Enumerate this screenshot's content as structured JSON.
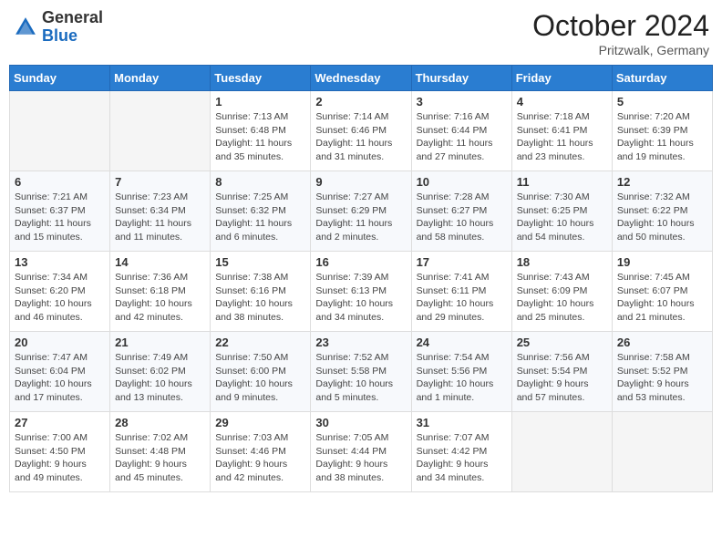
{
  "header": {
    "logo_general": "General",
    "logo_blue": "Blue",
    "month_year": "October 2024",
    "location": "Pritzwalk, Germany"
  },
  "days_of_week": [
    "Sunday",
    "Monday",
    "Tuesday",
    "Wednesday",
    "Thursday",
    "Friday",
    "Saturday"
  ],
  "weeks": [
    [
      {
        "day": "",
        "sunrise": "",
        "sunset": "",
        "daylight": ""
      },
      {
        "day": "",
        "sunrise": "",
        "sunset": "",
        "daylight": ""
      },
      {
        "day": "1",
        "sunrise": "Sunrise: 7:13 AM",
        "sunset": "Sunset: 6:48 PM",
        "daylight": "Daylight: 11 hours and 35 minutes."
      },
      {
        "day": "2",
        "sunrise": "Sunrise: 7:14 AM",
        "sunset": "Sunset: 6:46 PM",
        "daylight": "Daylight: 11 hours and 31 minutes."
      },
      {
        "day": "3",
        "sunrise": "Sunrise: 7:16 AM",
        "sunset": "Sunset: 6:44 PM",
        "daylight": "Daylight: 11 hours and 27 minutes."
      },
      {
        "day": "4",
        "sunrise": "Sunrise: 7:18 AM",
        "sunset": "Sunset: 6:41 PM",
        "daylight": "Daylight: 11 hours and 23 minutes."
      },
      {
        "day": "5",
        "sunrise": "Sunrise: 7:20 AM",
        "sunset": "Sunset: 6:39 PM",
        "daylight": "Daylight: 11 hours and 19 minutes."
      }
    ],
    [
      {
        "day": "6",
        "sunrise": "Sunrise: 7:21 AM",
        "sunset": "Sunset: 6:37 PM",
        "daylight": "Daylight: 11 hours and 15 minutes."
      },
      {
        "day": "7",
        "sunrise": "Sunrise: 7:23 AM",
        "sunset": "Sunset: 6:34 PM",
        "daylight": "Daylight: 11 hours and 11 minutes."
      },
      {
        "day": "8",
        "sunrise": "Sunrise: 7:25 AM",
        "sunset": "Sunset: 6:32 PM",
        "daylight": "Daylight: 11 hours and 6 minutes."
      },
      {
        "day": "9",
        "sunrise": "Sunrise: 7:27 AM",
        "sunset": "Sunset: 6:29 PM",
        "daylight": "Daylight: 11 hours and 2 minutes."
      },
      {
        "day": "10",
        "sunrise": "Sunrise: 7:28 AM",
        "sunset": "Sunset: 6:27 PM",
        "daylight": "Daylight: 10 hours and 58 minutes."
      },
      {
        "day": "11",
        "sunrise": "Sunrise: 7:30 AM",
        "sunset": "Sunset: 6:25 PM",
        "daylight": "Daylight: 10 hours and 54 minutes."
      },
      {
        "day": "12",
        "sunrise": "Sunrise: 7:32 AM",
        "sunset": "Sunset: 6:22 PM",
        "daylight": "Daylight: 10 hours and 50 minutes."
      }
    ],
    [
      {
        "day": "13",
        "sunrise": "Sunrise: 7:34 AM",
        "sunset": "Sunset: 6:20 PM",
        "daylight": "Daylight: 10 hours and 46 minutes."
      },
      {
        "day": "14",
        "sunrise": "Sunrise: 7:36 AM",
        "sunset": "Sunset: 6:18 PM",
        "daylight": "Daylight: 10 hours and 42 minutes."
      },
      {
        "day": "15",
        "sunrise": "Sunrise: 7:38 AM",
        "sunset": "Sunset: 6:16 PM",
        "daylight": "Daylight: 10 hours and 38 minutes."
      },
      {
        "day": "16",
        "sunrise": "Sunrise: 7:39 AM",
        "sunset": "Sunset: 6:13 PM",
        "daylight": "Daylight: 10 hours and 34 minutes."
      },
      {
        "day": "17",
        "sunrise": "Sunrise: 7:41 AM",
        "sunset": "Sunset: 6:11 PM",
        "daylight": "Daylight: 10 hours and 29 minutes."
      },
      {
        "day": "18",
        "sunrise": "Sunrise: 7:43 AM",
        "sunset": "Sunset: 6:09 PM",
        "daylight": "Daylight: 10 hours and 25 minutes."
      },
      {
        "day": "19",
        "sunrise": "Sunrise: 7:45 AM",
        "sunset": "Sunset: 6:07 PM",
        "daylight": "Daylight: 10 hours and 21 minutes."
      }
    ],
    [
      {
        "day": "20",
        "sunrise": "Sunrise: 7:47 AM",
        "sunset": "Sunset: 6:04 PM",
        "daylight": "Daylight: 10 hours and 17 minutes."
      },
      {
        "day": "21",
        "sunrise": "Sunrise: 7:49 AM",
        "sunset": "Sunset: 6:02 PM",
        "daylight": "Daylight: 10 hours and 13 minutes."
      },
      {
        "day": "22",
        "sunrise": "Sunrise: 7:50 AM",
        "sunset": "Sunset: 6:00 PM",
        "daylight": "Daylight: 10 hours and 9 minutes."
      },
      {
        "day": "23",
        "sunrise": "Sunrise: 7:52 AM",
        "sunset": "Sunset: 5:58 PM",
        "daylight": "Daylight: 10 hours and 5 minutes."
      },
      {
        "day": "24",
        "sunrise": "Sunrise: 7:54 AM",
        "sunset": "Sunset: 5:56 PM",
        "daylight": "Daylight: 10 hours and 1 minute."
      },
      {
        "day": "25",
        "sunrise": "Sunrise: 7:56 AM",
        "sunset": "Sunset: 5:54 PM",
        "daylight": "Daylight: 9 hours and 57 minutes."
      },
      {
        "day": "26",
        "sunrise": "Sunrise: 7:58 AM",
        "sunset": "Sunset: 5:52 PM",
        "daylight": "Daylight: 9 hours and 53 minutes."
      }
    ],
    [
      {
        "day": "27",
        "sunrise": "Sunrise: 7:00 AM",
        "sunset": "Sunset: 4:50 PM",
        "daylight": "Daylight: 9 hours and 49 minutes."
      },
      {
        "day": "28",
        "sunrise": "Sunrise: 7:02 AM",
        "sunset": "Sunset: 4:48 PM",
        "daylight": "Daylight: 9 hours and 45 minutes."
      },
      {
        "day": "29",
        "sunrise": "Sunrise: 7:03 AM",
        "sunset": "Sunset: 4:46 PM",
        "daylight": "Daylight: 9 hours and 42 minutes."
      },
      {
        "day": "30",
        "sunrise": "Sunrise: 7:05 AM",
        "sunset": "Sunset: 4:44 PM",
        "daylight": "Daylight: 9 hours and 38 minutes."
      },
      {
        "day": "31",
        "sunrise": "Sunrise: 7:07 AM",
        "sunset": "Sunset: 4:42 PM",
        "daylight": "Daylight: 9 hours and 34 minutes."
      },
      {
        "day": "",
        "sunrise": "",
        "sunset": "",
        "daylight": ""
      },
      {
        "day": "",
        "sunrise": "",
        "sunset": "",
        "daylight": ""
      }
    ]
  ]
}
